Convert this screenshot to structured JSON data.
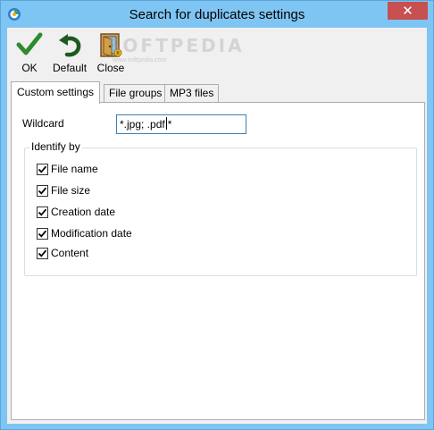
{
  "window": {
    "title": "Search for duplicates settings",
    "close_glyph": "✕"
  },
  "toolbar": {
    "ok_label": "OK",
    "default_label": "Default",
    "close_label": "Close",
    "watermark": "SOFTPEDIA",
    "watermark_sub": "www.softpedia.com"
  },
  "tabs": [
    {
      "label": "Custom settings",
      "active": true
    },
    {
      "label": "File groups",
      "active": false
    },
    {
      "label": "MP3 files",
      "active": false
    }
  ],
  "wildcard": {
    "label": "Wildcard",
    "value_before_caret": "*.jpg; .pdf",
    "value_after_caret": "*"
  },
  "identify": {
    "legend": "Identify by",
    "options": [
      {
        "label": "File name",
        "checked": true
      },
      {
        "label": "File size",
        "checked": true
      },
      {
        "label": "Creation date",
        "checked": true
      },
      {
        "label": "Modification date",
        "checked": true
      },
      {
        "label": "Content",
        "checked": true
      }
    ]
  },
  "colors": {
    "frame": "#7fc5f3",
    "close_button": "#c75050",
    "check_green": "#2e8b2e",
    "default_icon": "#1e5a1e"
  }
}
